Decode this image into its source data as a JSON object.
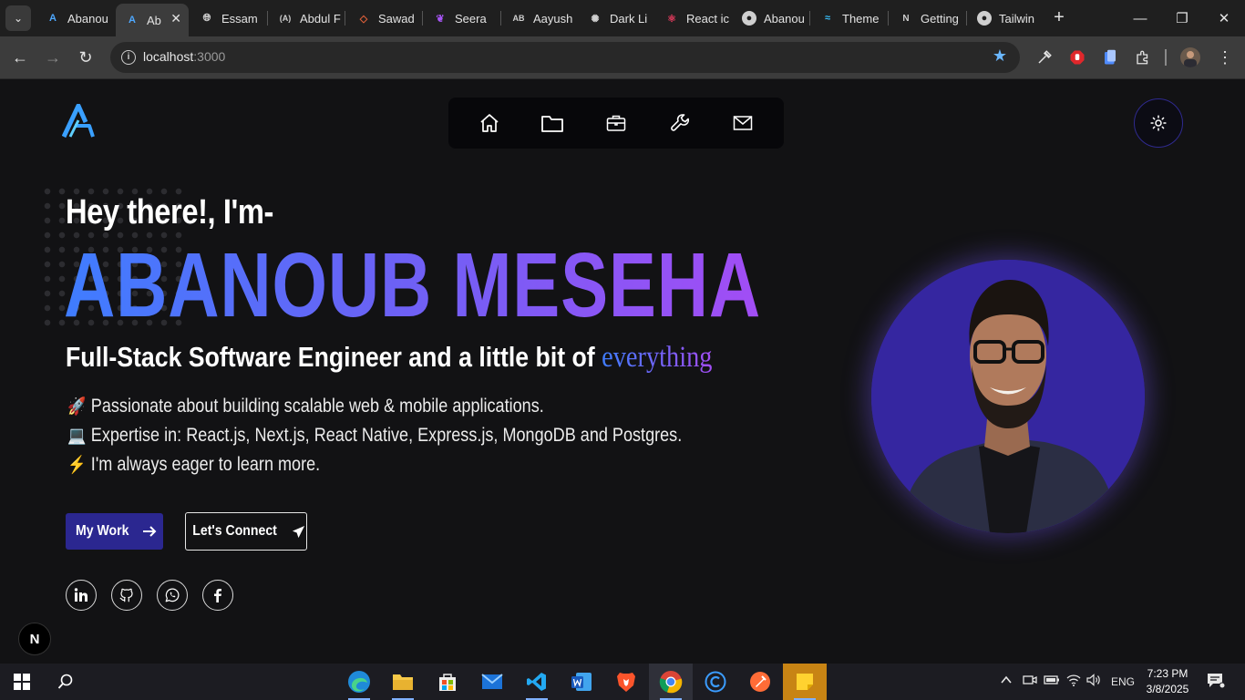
{
  "browser": {
    "tabs": [
      {
        "title": "Abanou",
        "icon": "a-logo-icon",
        "color": "#4ea8ff",
        "active": false
      },
      {
        "title": "Ab",
        "icon": "a-logo-icon",
        "color": "#4ea8ff",
        "active": true
      },
      {
        "title": "Essam",
        "icon": "globe-icon",
        "color": "#cfcfcf",
        "active": false
      },
      {
        "title": "Abdul F",
        "icon": "a-bracket-icon",
        "color": "#cfcfcf",
        "active": false
      },
      {
        "title": "Sawad",
        "icon": "diamond-icon",
        "color": "#e0603a",
        "active": false
      },
      {
        "title": "Seera",
        "icon": "leaf-icon",
        "color": "#a855f7",
        "active": false
      },
      {
        "title": "Aayush",
        "icon": "ab-logo-icon",
        "color": "#cfcfcf",
        "active": false
      },
      {
        "title": "Dark Li",
        "icon": "openai-icon",
        "color": "#cfcfcf",
        "active": false
      },
      {
        "title": "React ic",
        "icon": "react-icon",
        "color": "#e03a5c",
        "active": false
      },
      {
        "title": "Abanou",
        "icon": "github-icon",
        "color": "#cfcfcf",
        "active": false
      },
      {
        "title": "Theme",
        "icon": "tailwind-icon",
        "color": "#38bdf8",
        "active": false
      },
      {
        "title": "Getting",
        "icon": "n-logo-icon",
        "color": "#cfcfcf",
        "active": false
      },
      {
        "title": "Tailwin",
        "icon": "github-icon",
        "color": "#cfcfcf",
        "active": false
      }
    ],
    "url_host": "localhost",
    "url_port": ":3000"
  },
  "page": {
    "greeting": "Hey there!, I'm-",
    "name": "ABANOUB MESEHA",
    "role_prefix": "Full-Stack Software Engineer and a little bit of",
    "role_highlight": "everything",
    "bullets": [
      {
        "icon": "🚀",
        "text": "Passionate about building scalable web & mobile applications."
      },
      {
        "icon": "💻",
        "text": "Expertise in: React.js, Next.js, React Native, Express.js, MongoDB and Postgres."
      },
      {
        "icon": "⚡",
        "text": "I'm always eager to learn more."
      }
    ],
    "primary_button": "My Work",
    "secondary_button": "Let's Connect",
    "nav_items": [
      "home-icon",
      "folder-icon",
      "briefcase-icon",
      "wrench-icon",
      "mail-icon"
    ],
    "socials": [
      "linkedin-icon",
      "github-icon",
      "whatsapp-icon",
      "facebook-icon"
    ],
    "next_badge": "N"
  },
  "taskbar": {
    "language": "ENG",
    "time": "7:23 PM",
    "date": "3/8/2025"
  },
  "colors": {
    "accent_blue": "#3f7dff",
    "accent_purple": "#a24df5",
    "button_primary": "#2b2790",
    "portrait_bg": "#3526a0"
  }
}
